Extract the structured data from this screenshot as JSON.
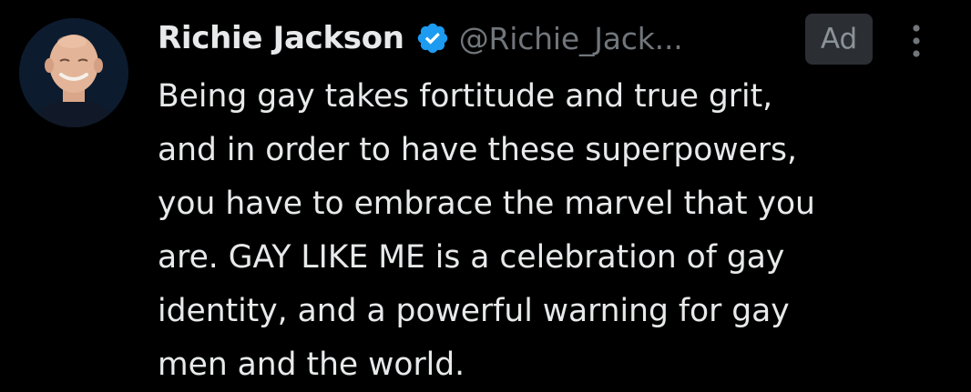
{
  "tweet": {
    "author": {
      "display_name": "Richie Jackson",
      "handle": "@Richie_Jack...",
      "verified": true,
      "avatar_icon": "profile-photo"
    },
    "ad_label": "Ad",
    "more_icon": "more-vertical-icon",
    "text_lines": [
      "Being gay takes fortitude and true grit,",
      "and in order to have these superpowers,",
      "you have to embrace the marvel that you",
      "are. GAY LIKE ME is a celebration of gay",
      "identity, and a powerful warning for gay",
      "men and the world."
    ]
  },
  "colors": {
    "background": "#000000",
    "primary_text": "#e7e9ea",
    "secondary_text": "#71767b",
    "verified_badge": "#1d9bf0",
    "ad_badge_bg": "#2b2f33"
  }
}
